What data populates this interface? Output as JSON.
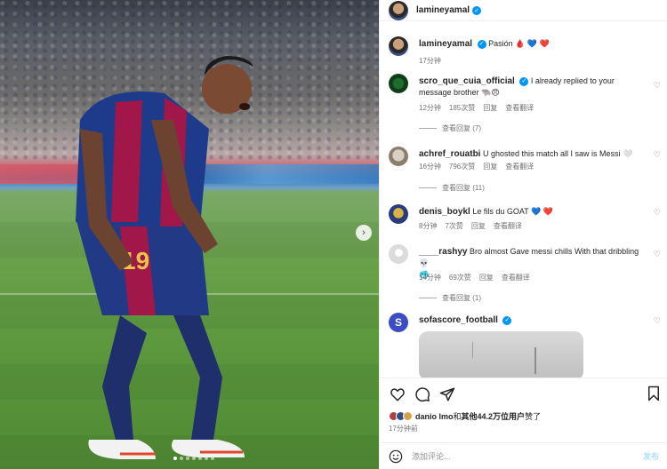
{
  "post": {
    "author": "lamineyamal",
    "caption_user": "lamineyamal",
    "caption_text": "Pasión",
    "caption_emojis": [
      "🩸",
      "💙",
      "❤️"
    ],
    "caption_time": "17分钟"
  },
  "comments": [
    {
      "user": "scro_que_cuia_official",
      "verified": true,
      "text": "I already replied to your message brother 🐃😠",
      "time": "12分钟",
      "likes": "185次赞",
      "reply": "回复",
      "translate": "查看翻译",
      "view_replies": "查看回复 (7)"
    },
    {
      "user": "achref_rouatbi",
      "verified": false,
      "text": "U ghosted this match all I saw is Messi 🤍",
      "time": "16分钟",
      "likes": "796次赞",
      "reply": "回复",
      "translate": "查看翻译",
      "view_replies": "查看回复 (11)"
    },
    {
      "user": "denis_boykl",
      "verified": false,
      "text": "Le fils du GOAT",
      "time": "8分钟",
      "likes": "7次赞",
      "reply": "回复",
      "translate": "查看翻译"
    },
    {
      "user": "____rashyy",
      "verified": false,
      "text": "Bro almost Gave messi chills With that dribbling 💀",
      "text_line2": "🥶",
      "time": "14分钟",
      "likes": "69次赞",
      "reply": "回复",
      "translate": "查看翻译",
      "view_replies": "查看回复 (1)"
    },
    {
      "user": "sofascore_football",
      "verified": true,
      "avatar_letter": "S"
    }
  ],
  "likes_summary": {
    "user": "danio lmo",
    "connector": "和",
    "others": "其他44.2万位用户",
    "suffix": "赞了"
  },
  "likes_time": "17分钟前",
  "add_comment": {
    "placeholder": "添加评论...",
    "post_label": "发布"
  },
  "icons": {
    "like": "heart-outline-icon",
    "comment": "comment-bubble-icon",
    "share": "paper-plane-icon",
    "save": "bookmark-icon"
  },
  "colors": {
    "verified": "#0095f6",
    "muted": "#737373",
    "post_button": "#b2dffc"
  }
}
